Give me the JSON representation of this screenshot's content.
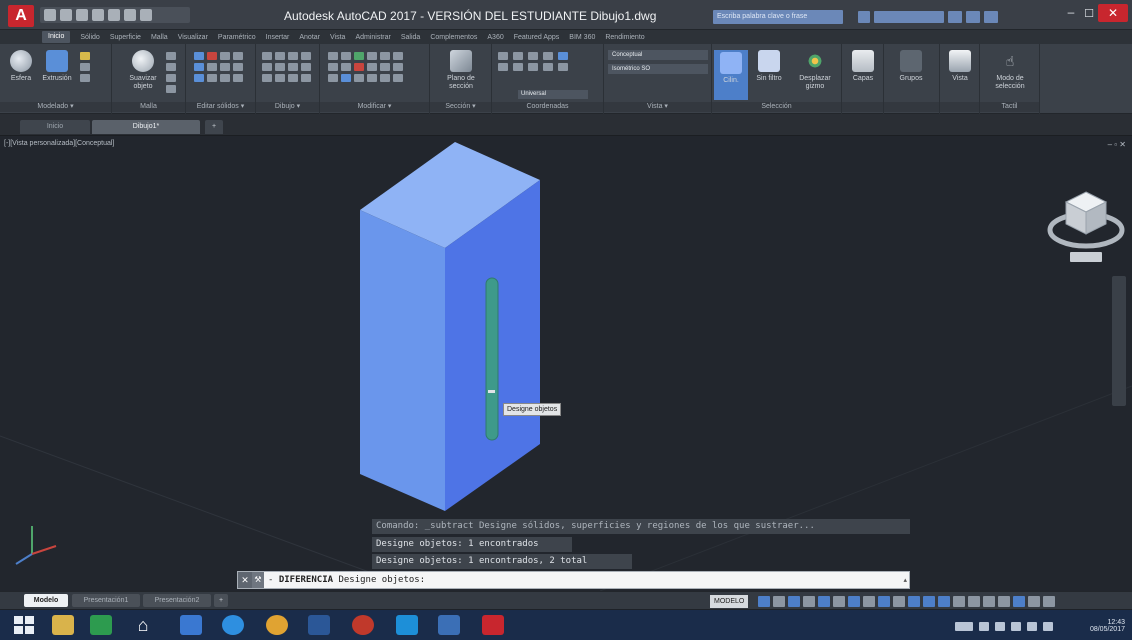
{
  "window": {
    "title": "Autodesk AutoCAD 2017 - VERSIÓN DEL ESTUDIANTE    Dibujo1.dwg",
    "app_logo": "A",
    "search_placeholder": "Escriba palabra clave o frase",
    "minimize": "–",
    "maximize": "☐",
    "close": "✕"
  },
  "ribbon_tabs": [
    "Inicio",
    "Sólido",
    "Superficie",
    "Malla",
    "Visualizar",
    "Paramétrico",
    "Insertar",
    "Anotar",
    "Vista",
    "Administrar",
    "Salida",
    "Complementos",
    "A360",
    "Featured Apps",
    "BIM 360",
    "Rendimiento"
  ],
  "ribbon_tabs_active": "Inicio",
  "ribbon": {
    "modelado": {
      "title": "Modelado ▾",
      "tools": [
        "Esfera",
        "Extrusión",
        "Suavizar objeto"
      ]
    },
    "malla": {
      "title": "Malla"
    },
    "editar_solidos": {
      "title": "Editar sólidos ▾"
    },
    "dibujo": {
      "title": "Dibujo ▾"
    },
    "modificar": {
      "title": "Modificar ▾"
    },
    "seccion": {
      "title": "Sección ▾",
      "tool": "Plano de sección"
    },
    "coordenadas": {
      "title": "Coordenadas"
    },
    "vista": {
      "title": "Vista ▾",
      "visual_style": "Conceptual",
      "view": "Isométrico SO",
      "ucs": "Universal"
    },
    "seleccion": {
      "title": "Selección",
      "tools": [
        "Cilin.",
        "Sin filtro",
        "Desplazar gizmo"
      ]
    },
    "capas": {
      "tool": "Capas"
    },
    "grupos": {
      "tool": "Grupos"
    },
    "vista2": {
      "tool": "Vista"
    },
    "modo": {
      "tool": "Modo de selección",
      "title": "Tactil"
    }
  },
  "doc_tabs": {
    "start": "Inicio",
    "drawing": "Dibujo1*",
    "add": "+"
  },
  "viewport": {
    "controls": "[-][Vista personalizada][Conceptual]",
    "win_buttons": "– ▫ ✕",
    "tooltip": "Designe objetos"
  },
  "command_history": [
    "Comando: _subtract Designe sólidos, superficies y regiones de los que sustraer...",
    "Designe objetos: 1 encontrados",
    "Designe objetos: 1 encontrados, 2 total"
  ],
  "command_line": {
    "close": "✕",
    "wrench": "🔧",
    "prompt_prefix": "- ",
    "command_name": "DIFERENCIA",
    "prompt": " Designe objetos:",
    "scroll": "▴"
  },
  "layout_tabs": {
    "model": "Modelo",
    "layout1": "Presentación1",
    "layout2": "Presentación2",
    "add": "+"
  },
  "status": {
    "modelo": "MODELO"
  },
  "clock": {
    "time": "12:43",
    "date": "08/05/2017"
  },
  "colors": {
    "box_top": "#8fb3f5",
    "box_left": "#6a96ec",
    "box_front": "#4e74e6",
    "slot": "#3e9a8a",
    "viewport_bg": "#22262d",
    "accent_red": "#c8262e"
  }
}
